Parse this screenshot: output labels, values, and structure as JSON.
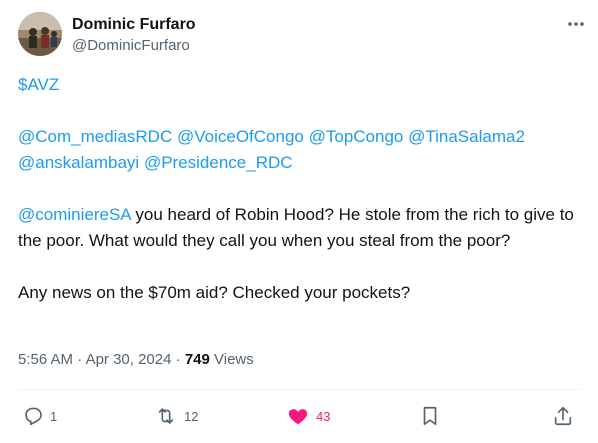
{
  "author": {
    "display_name": "Dominic Furfaro",
    "handle": "@DominicFurfaro"
  },
  "tweet": {
    "cashtag": "$AVZ",
    "mentions": [
      "@Com_mediasRDC",
      "@VoiceOfCongo",
      "@TopCongo",
      "@TinaSalama2",
      "@anskalambayi",
      "@Presidence_RDC"
    ],
    "reply_mention": "@cominiereSA",
    "text_1": " you heard of Robin Hood? He stole from the rich to give to the poor. What would they call you when you steal from the poor?",
    "text_2": "Any news on the $70m aid? Checked your pockets?"
  },
  "meta": {
    "time": "5:56 AM",
    "separator": " · ",
    "date": "Apr 30, 2024",
    "views_count": "749",
    "views_label": "Views"
  },
  "actions": {
    "reply_count": "1",
    "retweet_count": "12",
    "like_count": "43"
  },
  "colors": {
    "link": "#1d9bf0",
    "like": "#f91880",
    "text": "#0f1419",
    "secondary": "#536471"
  },
  "icons": [
    "more-icon",
    "reply-icon",
    "retweet-icon",
    "heart-icon",
    "bookmark-icon",
    "share-icon"
  ]
}
